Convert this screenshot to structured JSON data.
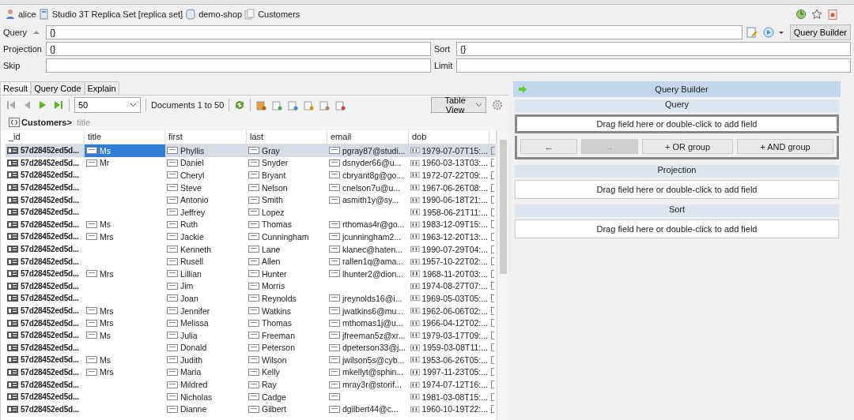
{
  "breadcrumb": [
    {
      "kind": "user",
      "label": "alice"
    },
    {
      "kind": "server",
      "label": "Studio 3T Replica Set [replica set]"
    },
    {
      "kind": "database",
      "label": "demo-shop"
    },
    {
      "kind": "collection",
      "label": "Customers"
    }
  ],
  "query": {
    "label": "Query",
    "value": "{}"
  },
  "projection": {
    "label": "Projection",
    "value": "{}"
  },
  "sort": {
    "label": "Sort",
    "value": "{}"
  },
  "skip": {
    "label": "Skip"
  },
  "limit": {
    "label": "Limit"
  },
  "query_builder_button": "Query Builder",
  "tabs": [
    {
      "label": "Result",
      "selected": true
    },
    {
      "label": "Query Code",
      "selected": false
    },
    {
      "label": "Explain",
      "selected": false
    }
  ],
  "page_size": "50",
  "documents": "Documents 1 to 50",
  "view_mode": "Table View",
  "path": {
    "collection": "Customers>",
    "field": "title"
  },
  "table": {
    "columns": [
      "_id",
      "title",
      "first",
      "last",
      "email",
      "dob"
    ],
    "rows": [
      {
        "id": "57d28452ed5d...",
        "title": "Ms",
        "first": "Phyllis",
        "last": "Gray",
        "email": "pgray87@studi...",
        "dob": "1979-07-07T15:...",
        "selected": true
      },
      {
        "id": "57d28452ed5d...",
        "title": "Mr",
        "first": "Daniel",
        "last": "Snyder",
        "email": "dsnyder66@u...",
        "dob": "1960-03-13T03:...",
        "selected": false
      },
      {
        "id": "57d28452ed5d...",
        "title": null,
        "first": "Cheryl",
        "last": "Bryant",
        "email": "cbryant8g@go...",
        "dob": "1972-07-22T09:...",
        "selected": false
      },
      {
        "id": "57d28452ed5d...",
        "title": null,
        "first": "Steve",
        "last": "Nelson",
        "email": "cnelson7u@u...",
        "dob": "1967-06-26T08:...",
        "selected": false
      },
      {
        "id": "57d28452ed5d...",
        "title": null,
        "first": "Antonio",
        "last": "Smith",
        "email": "asmith1y@sy...",
        "dob": "1990-06-18T21:...",
        "selected": false
      },
      {
        "id": "57d28452ed5d...",
        "title": null,
        "first": "Jeffrey",
        "last": "Lopez",
        "email": null,
        "dob": "1958-06-21T11:...",
        "selected": false
      },
      {
        "id": "57d28452ed5d...",
        "title": "Ms",
        "first": "Ruth",
        "last": "Thomas",
        "email": "rthomas4r@go...",
        "dob": "1983-12-09T15:...",
        "selected": false
      },
      {
        "id": "57d28452ed5d...",
        "title": "Mrs",
        "first": "Jackie",
        "last": "Cunningham",
        "email": "jcunningham2...",
        "dob": "1963-12-20T13:...",
        "selected": false
      },
      {
        "id": "57d28452ed5d...",
        "title": null,
        "first": "Kenneth",
        "last": "Lane",
        "email": "klanec@haten...",
        "dob": "1990-07-29T04:...",
        "selected": false
      },
      {
        "id": "57d28452ed5d...",
        "title": null,
        "first": "Rusell",
        "last": "Allen",
        "email": "rallen1q@ama...",
        "dob": "1957-10-22T02:...",
        "selected": false
      },
      {
        "id": "57d28452ed5d...",
        "title": "Mrs",
        "first": "Lillian",
        "last": "Hunter",
        "email": "lhunter2@dion...",
        "dob": "1968-11-20T03:...",
        "selected": false
      },
      {
        "id": "57d28452ed5d...",
        "title": null,
        "first": "Jim",
        "last": "Morris",
        "email": null,
        "dob": "1974-08-27T07:...",
        "selected": false
      },
      {
        "id": "57d28452ed5d...",
        "title": null,
        "first": "Joan",
        "last": "Reynolds",
        "email": "jreynolds16@i...",
        "dob": "1969-05-03T05:...",
        "selected": false
      },
      {
        "id": "57d28452ed5d...",
        "title": "Mrs",
        "first": "Jennifer",
        "last": "Watkins",
        "email": "jwatkins6@mu...",
        "dob": "1962-06-06T02:...",
        "selected": false
      },
      {
        "id": "57d28452ed5d...",
        "title": "Mrs",
        "first": "Melissa",
        "last": "Thomas",
        "email": "mthomas1j@u...",
        "dob": "1966-04-12T02:...",
        "selected": false
      },
      {
        "id": "57d28452ed5d...",
        "title": "Ms",
        "first": "Julia",
        "last": "Freeman",
        "email": "jfreeman5z@xr...",
        "dob": "1979-03-17T09:...",
        "selected": false
      },
      {
        "id": "57d28452ed5d...",
        "title": null,
        "first": "Donald",
        "last": "Peterson",
        "email": "dpeterson33@j...",
        "dob": "1959-03-08T11:...",
        "selected": false
      },
      {
        "id": "57d28452ed5d...",
        "title": "Ms",
        "first": "Judith",
        "last": "Wilson",
        "email": "jwilson5s@cyb...",
        "dob": "1953-06-26T05:...",
        "selected": false
      },
      {
        "id": "57d28452ed5d...",
        "title": "Mrs",
        "first": "Maria",
        "last": "Kelly",
        "email": "mkellyt@sphin...",
        "dob": "1997-11-23T05:...",
        "selected": false
      },
      {
        "id": "57d28452ed5d...",
        "title": null,
        "first": "Mildred",
        "last": "Ray",
        "email": "mray3r@storif...",
        "dob": "1974-07-12T16:...",
        "selected": false
      },
      {
        "id": "57d28452ed5d...",
        "title": null,
        "first": "Nicholas",
        "last": "Cadge",
        "email": {
          "empty": true
        },
        "dob": "1981-03-08T15:...",
        "selected": false
      },
      {
        "id": "57d28452ed5d...",
        "title": null,
        "first": "Dianne",
        "last": "Gilbert",
        "email": "dgilbert44@c...",
        "dob": "1960-10-19T22:...",
        "selected": false
      }
    ]
  },
  "builder": {
    "title": "Query Builder",
    "sections": [
      {
        "title": "Query",
        "placeholder": "Drag field here or double-click to add field",
        "buttons": [
          {
            "label": "←",
            "disabled": false
          },
          {
            "label": "→",
            "disabled": true
          },
          {
            "label": "+ OR group",
            "disabled": false
          },
          {
            "label": "+ AND group",
            "disabled": false
          }
        ]
      },
      {
        "title": "Projection",
        "placeholder": "Drag field here or double-click to add field"
      },
      {
        "title": "Sort",
        "placeholder": "Drag field here or double-click to add field"
      }
    ]
  }
}
